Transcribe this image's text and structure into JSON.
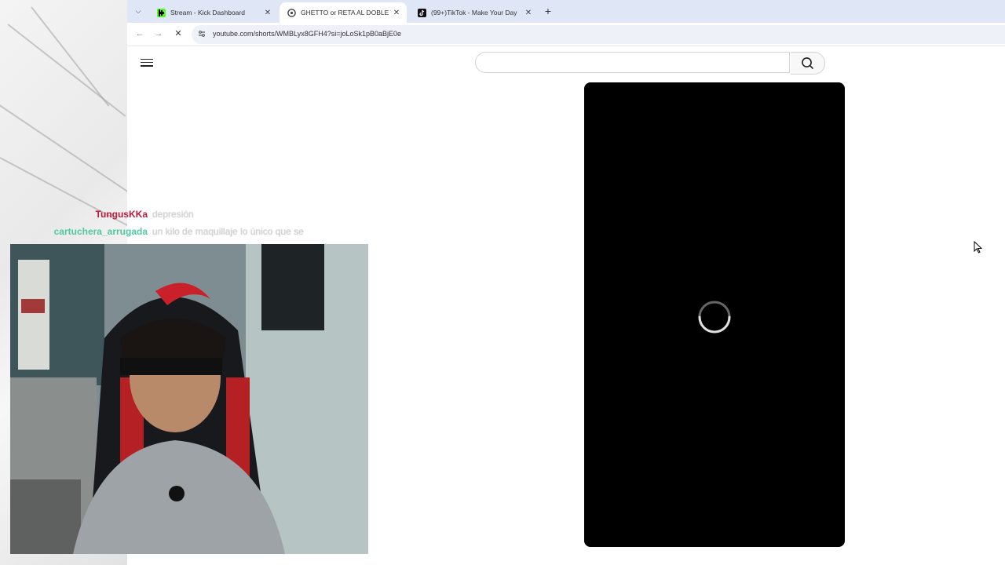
{
  "browser": {
    "tabs": [
      {
        "title": "Stream - Kick Dashboard",
        "favicon": "kick-icon",
        "active": false
      },
      {
        "title": "GHETTO or RETA AL DOBLE TEN",
        "favicon": "chrome-icon",
        "active": true
      },
      {
        "title": "(99+)TikTok - Make Your Day",
        "favicon": "tiktok-icon",
        "active": false
      }
    ],
    "url": "youtube.com/shorts/WMBLyx8GFH4?si=joLoSk1pB0aBjE0e"
  },
  "youtube": {
    "search_placeholder": "",
    "player_state": "loading"
  },
  "stream_overlay": {
    "chat": [
      {
        "user": "TungusKKa",
        "message": "depresión",
        "color": "#c0183a"
      },
      {
        "user": "cartuchera_arrugada",
        "message": "un kilo de maquillaje lo único que se",
        "color": "#4fc9a0"
      }
    ]
  },
  "colors": {
    "tabstrip": "#dfe7f7",
    "player": "#000000",
    "kick_green": "#53fc18"
  }
}
